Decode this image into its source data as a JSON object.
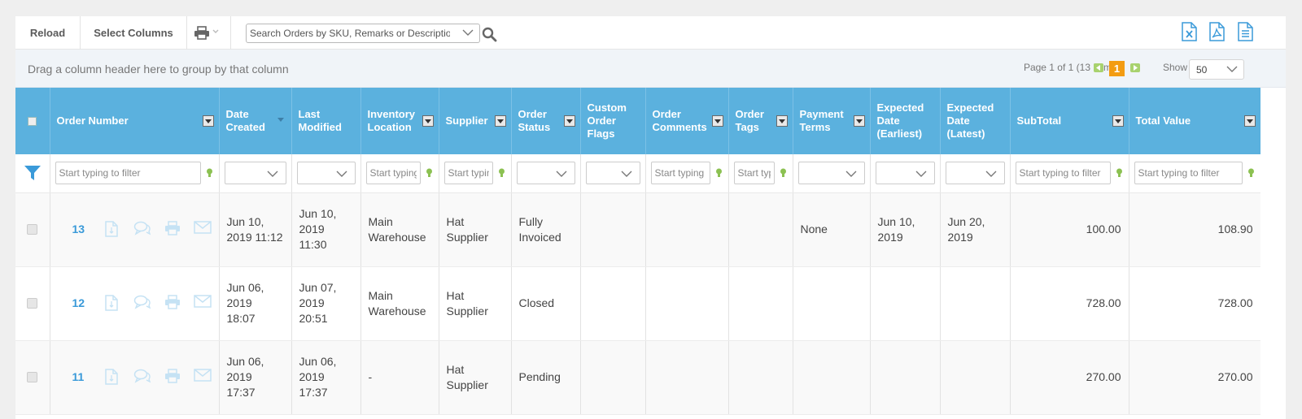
{
  "toolbar": {
    "reload_label": "Reload",
    "select_columns_label": "Select Columns",
    "print_icon": "printer-icon",
    "search_placeholder": "Search Orders by SKU, Remarks or Description",
    "export_icons": [
      "excel-icon",
      "pdf-icon",
      "document-icon"
    ]
  },
  "groupbar": {
    "hint": "Drag a column header here to group by that column",
    "page_info": "Page 1 of 1 (13 items)",
    "current_page": "1",
    "show_label": "Show",
    "page_size": "50"
  },
  "colors": {
    "header_bg": "#5bb1de",
    "link": "#3a9ad9",
    "page_active": "#f39c12",
    "pager_arrow": "#a8d26e"
  },
  "columns": [
    {
      "key": "order_number",
      "label": "Order Number",
      "has_menu": true
    },
    {
      "key": "date_created",
      "label": "Date Created",
      "sorted": "desc"
    },
    {
      "key": "last_modified",
      "label": "Last Modified"
    },
    {
      "key": "inventory_location",
      "label": "Inventory Location",
      "has_menu": true
    },
    {
      "key": "supplier",
      "label": "Supplier",
      "has_menu": true
    },
    {
      "key": "order_status",
      "label": "Order Status",
      "has_menu": true
    },
    {
      "key": "custom_order_flags",
      "label": "Custom Order Flags"
    },
    {
      "key": "order_comments",
      "label": "Order Comments",
      "has_menu": true
    },
    {
      "key": "order_tags",
      "label": "Order Tags",
      "has_menu": true
    },
    {
      "key": "payment_terms",
      "label": "Payment Terms",
      "has_menu": true
    },
    {
      "key": "expected_earliest",
      "label": "Expected Date (Earliest)"
    },
    {
      "key": "expected_latest",
      "label": "Expected Date (Latest)"
    },
    {
      "key": "subtotal",
      "label": "SubTotal",
      "has_menu": true
    },
    {
      "key": "total_value",
      "label": "Total Value",
      "has_menu": true
    }
  ],
  "filters": {
    "order_number": "Start typing to filter",
    "inventory_location": "Start typing to filter",
    "supplier": "Start typing to filter",
    "order_comments": "Start typing to filter",
    "order_tags": "Start typing to filter",
    "subtotal": "Start typing to filter",
    "total_value": "Start typing to filter"
  },
  "rows": [
    {
      "order_number": "13",
      "date_created": "Jun 10, 2019 11:12",
      "last_modified": "Jun 10, 2019 11:30",
      "inventory_location": "Main Warehouse",
      "supplier": "Hat Supplier",
      "order_status": "Fully Invoiced",
      "custom_order_flags": "",
      "order_comments": "",
      "order_tags": "",
      "payment_terms": "None",
      "expected_earliest": "Jun 10, 2019",
      "expected_latest": "Jun 20, 2019",
      "subtotal": "100.00",
      "total_value": "108.90"
    },
    {
      "order_number": "12",
      "date_created": "Jun 06, 2019 18:07",
      "last_modified": "Jun 07, 2019 20:51",
      "inventory_location": "Main Warehouse",
      "supplier": "Hat Supplier",
      "order_status": "Closed",
      "custom_order_flags": "",
      "order_comments": "",
      "order_tags": "",
      "payment_terms": "",
      "expected_earliest": "",
      "expected_latest": "",
      "subtotal": "728.00",
      "total_value": "728.00"
    },
    {
      "order_number": "11",
      "date_created": "Jun 06, 2019 17:37",
      "last_modified": "Jun 06, 2019 17:37",
      "inventory_location": "-",
      "supplier": "Hat Supplier",
      "order_status": "Pending",
      "custom_order_flags": "",
      "order_comments": "",
      "order_tags": "",
      "payment_terms": "",
      "expected_earliest": "",
      "expected_latest": "",
      "subtotal": "270.00",
      "total_value": "270.00"
    }
  ],
  "row_action_icons": [
    "document-icon",
    "comment-icon",
    "printer-icon",
    "email-icon"
  ]
}
